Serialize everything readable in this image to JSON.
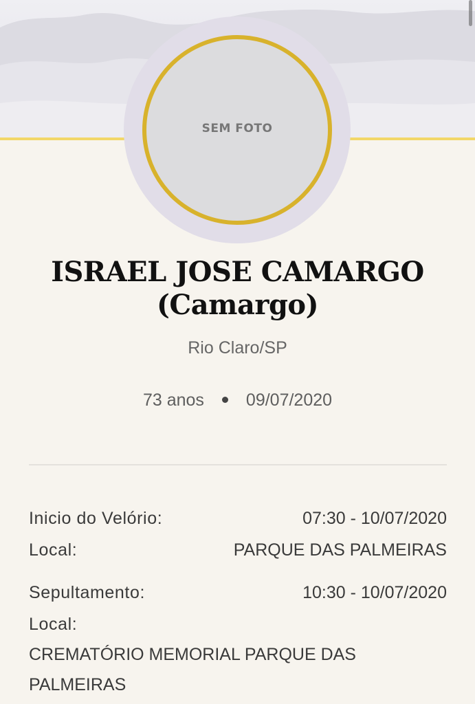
{
  "photo": {
    "placeholder": "SEM FOTO"
  },
  "person": {
    "name": "ISRAEL JOSE CAMARGO",
    "nickname": "(Camargo)",
    "city": "Rio Claro/SP",
    "age": "73 anos",
    "death_date": "09/07/2020"
  },
  "velorio": {
    "label": "Inicio do Velório:",
    "value": "07:30 - 10/07/2020",
    "local_label": "Local:",
    "local_value": "PARQUE DAS PALMEIRAS"
  },
  "sepultamento": {
    "label": "Sepultamento:",
    "value": "10:30 - 10/07/2020",
    "local_label": "Local:",
    "local_value": "CREMATÓRIO MEMORIAL PARQUE DAS PALMEIRAS"
  },
  "colors": {
    "accent_gold": "#d8b22c",
    "header_line": "#f2d768",
    "background": "#f7f4ee"
  }
}
